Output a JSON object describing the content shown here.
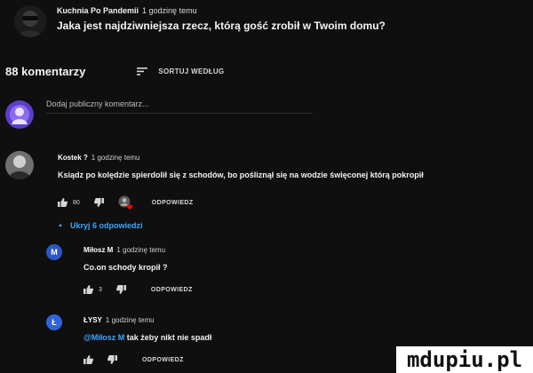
{
  "post": {
    "channel": "Kuchnia Po Pandemii",
    "time": "1 godzinę temu",
    "text": "Jaka jest najdziwniejsza rzecz, którą gość zrobił w Twoim domu?"
  },
  "comments_header": {
    "count_label": "88 komentarzy",
    "sort_label": "SORTUJ WEDŁUG",
    "sort_icon": "sort-icon"
  },
  "add_comment": {
    "placeholder": "Dodaj publiczny komentarz..."
  },
  "comments": [
    {
      "author": "Kostek ?",
      "time": "1 godzinę temu",
      "text": "Ksiądz po kolędzie spierdolił się z schodów, bo pośliznął się na wodzie święconej którą pokropił",
      "likes": "80",
      "reply_label": "ODPOWIEDZ",
      "hearted": true
    }
  ],
  "replies_toggle": {
    "label": "Ukryj 6 odpowiedzi",
    "icon": "caret-up-icon"
  },
  "replies": [
    {
      "avatar_letter": "M",
      "avatar_color": "#2b57c5",
      "author": "Miłosz M",
      "time": "1 godzinę temu",
      "text": "Co.on schody kropił ?",
      "likes": "3",
      "reply_label": "ODPOWIEDZ"
    },
    {
      "avatar_letter": "Ł",
      "avatar_color": "#2f63d6",
      "author": "ŁYSY",
      "time": "1 godzinę temu",
      "mention": "@Miłosz M",
      "text": "tak żeby nikt nie spadł",
      "likes": "",
      "reply_label": "ODPOWIEDZ"
    }
  ],
  "watermark": {
    "text": "mdupiu.pl"
  },
  "colors": {
    "background": "#0f0f0f",
    "link": "#3ea6ff",
    "heart": "#ff0000"
  }
}
